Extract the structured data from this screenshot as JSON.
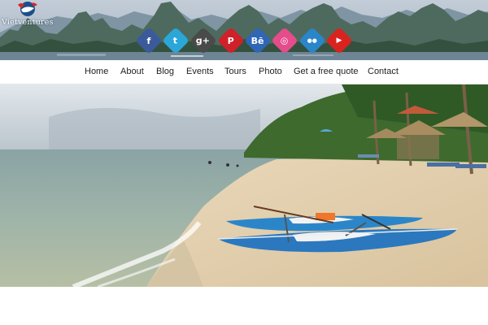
{
  "brand": {
    "name": "Vietventures"
  },
  "social": [
    {
      "name": "facebook-icon",
      "glyph": "f",
      "color": "#3b5a9a"
    },
    {
      "name": "twitter-icon",
      "glyph": "t",
      "color": "#2aa7d8"
    },
    {
      "name": "google-plus-icon",
      "glyph": "g+",
      "color": "#4a4a4a"
    },
    {
      "name": "pinterest-icon",
      "glyph": "P",
      "color": "#d0202a"
    },
    {
      "name": "behance-icon",
      "glyph": "Bē",
      "color": "#2f66b8"
    },
    {
      "name": "dribbble-icon",
      "glyph": "◎",
      "color": "#e54c8b"
    },
    {
      "name": "flickr-icon",
      "glyph": "●●",
      "color": "#2a85c9"
    },
    {
      "name": "youtube-icon",
      "glyph": "▶",
      "color": "#d9231f"
    }
  ],
  "nav": {
    "items": [
      "Home",
      "About",
      "Blog",
      "Events",
      "Tours",
      "Photo",
      "Get a free quote",
      "Contact"
    ]
  },
  "hero": {
    "scene": "beach-with-kayaks"
  }
}
